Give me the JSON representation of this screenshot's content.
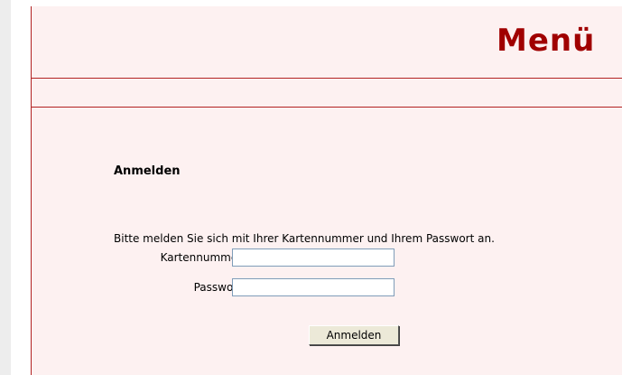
{
  "header": {
    "title": "Menü"
  },
  "login": {
    "heading": "Anmelden",
    "instruction": "Bitte melden Sie sich mit Ihrer Kartennummer und Ihrem Passwort an.",
    "card_number_label": "Kartennummer:",
    "card_number_value": "",
    "password_label": "Passwort:",
    "password_value": "",
    "submit_label": "Anmelden"
  },
  "colors": {
    "accent": "#a00000",
    "line": "#b22222",
    "panel_background": "#fdf1f1"
  }
}
